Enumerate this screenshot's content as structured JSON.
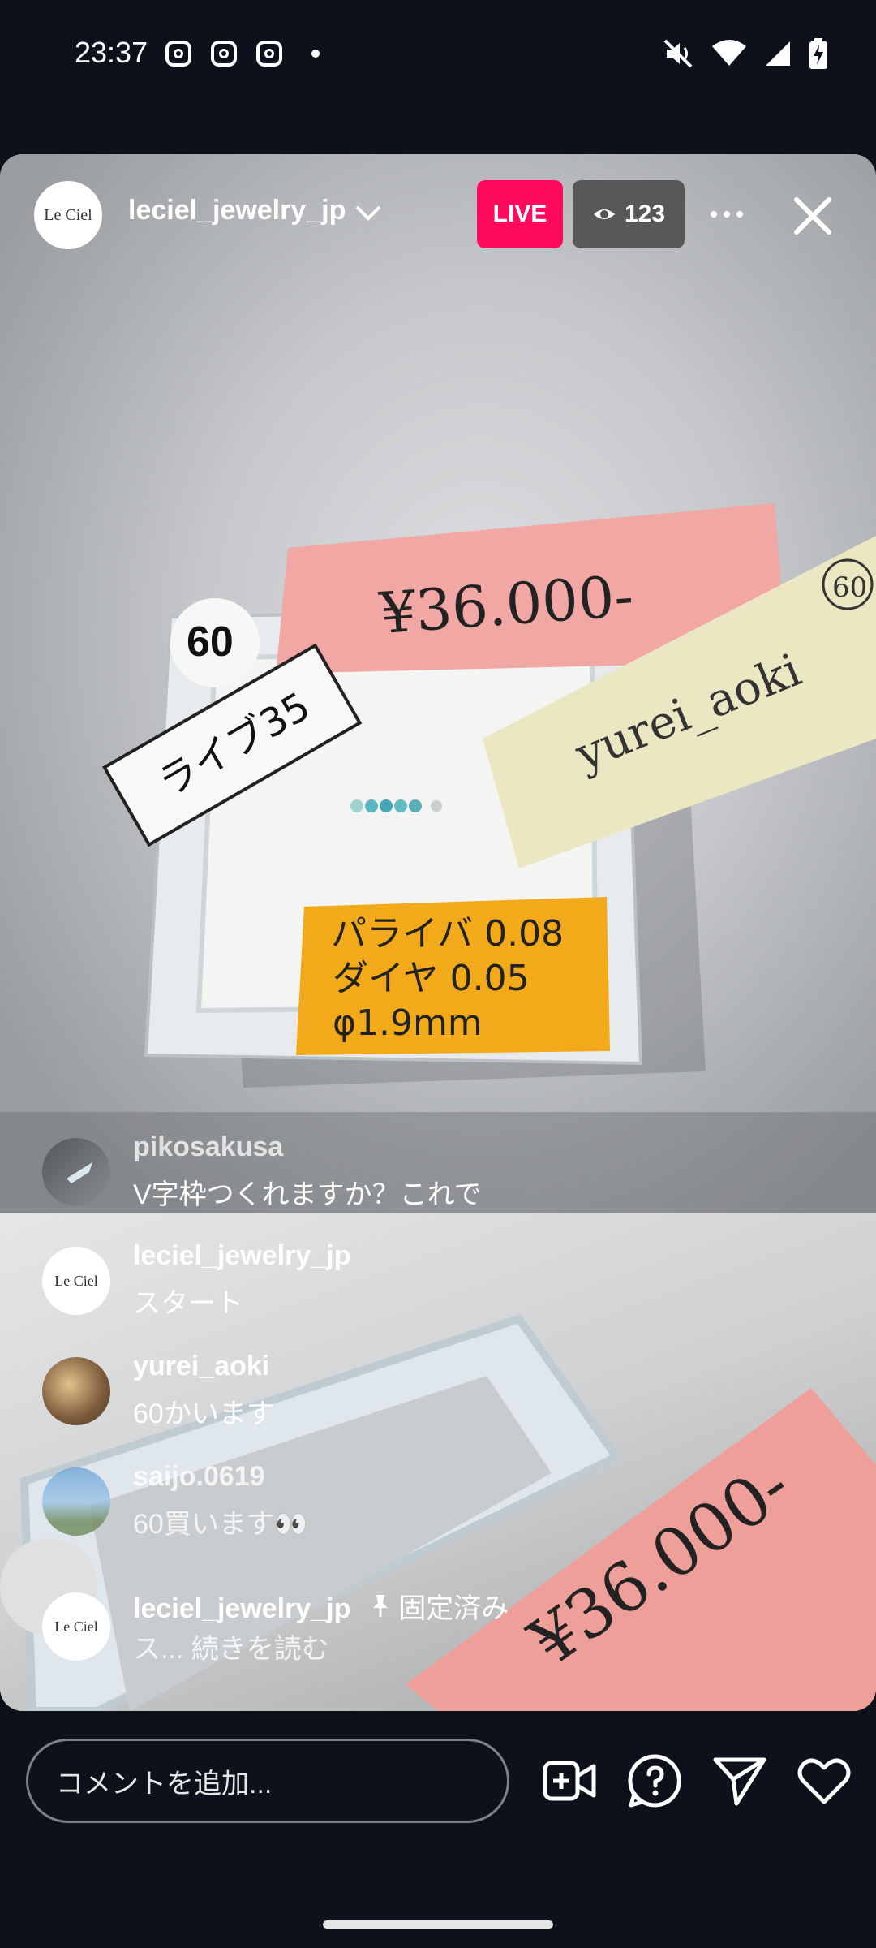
{
  "status_bar": {
    "time": "23:37"
  },
  "header": {
    "logo_text": "Le Ciel",
    "account": "leciel_jewelry_jp",
    "live_label": "LIVE",
    "viewer_count": "123"
  },
  "scene_text": {
    "price_note": "¥36.000-",
    "number_tag": "60",
    "label_card": "ライブ35",
    "buyer_note": "yurei_aoki",
    "buyer_circle": "60",
    "orange_line1": "パライバ 0.08",
    "orange_line2": "ダイヤ 0.05",
    "orange_line3": "φ1.9mm",
    "lower_price": "¥36.000-"
  },
  "comments": [
    {
      "user": "pikosakusa",
      "text": "V字枠つくれますか？これで"
    },
    {
      "user": "leciel_jewelry_jp",
      "text": "スタート"
    },
    {
      "user": "yurei_aoki",
      "text": "60かいます"
    },
    {
      "user": "saijo.0619",
      "text": "60買います👀"
    },
    {
      "user": "leciel_jewelry_jp",
      "pinned_label": "固定済み",
      "text": "ス... 続きを読む"
    }
  ],
  "bottom_bar": {
    "comment_placeholder": "コメントを追加..."
  }
}
